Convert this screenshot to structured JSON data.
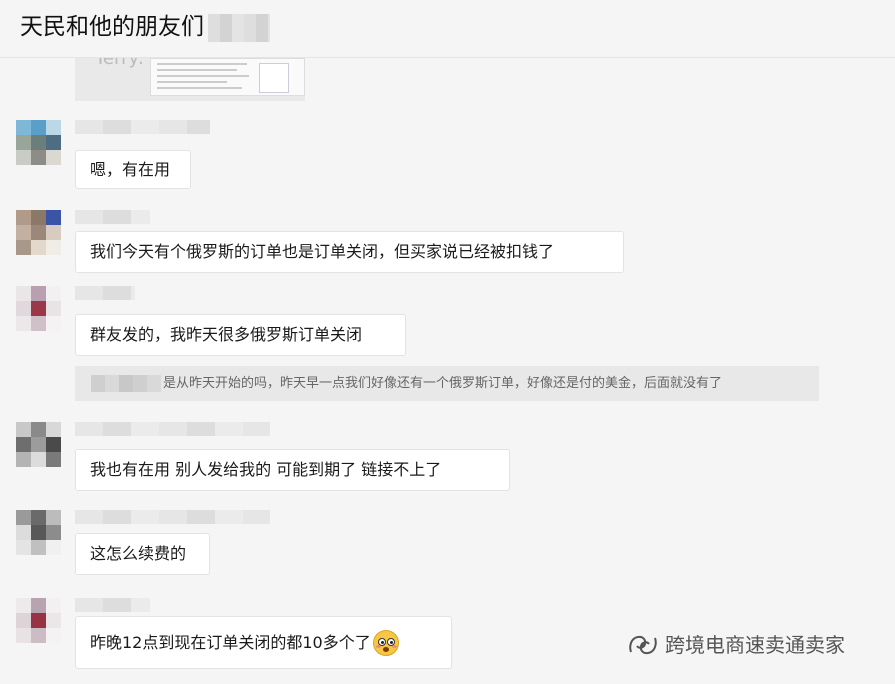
{
  "header": {
    "title": "天民和他的朋友们"
  },
  "image_message": {
    "label": "Terry:"
  },
  "messages": [
    {
      "text": "嗯，有在用"
    },
    {
      "text": "我们今天有个俄罗斯的订单也是订单关闭，但买家说已经被扣钱了"
    },
    {
      "text": "群友发的，我昨天很多俄罗斯订单关闭"
    },
    {
      "text": "我也有在用  别人发给我的  可能到期了  链接不上了"
    },
    {
      "text": "这怎么续费的"
    },
    {
      "text": "昨晚12点到现在订单关闭的都10多个了"
    }
  ],
  "quote": {
    "text": "是从昨天开始的吗，昨天早一点我们好像还有一个俄罗斯订单，好像还是付的美金，后面就没有了"
  },
  "emoji": {
    "icon": "flushed-face-icon"
  },
  "watermark": {
    "text": "跨境电商速卖通卖家",
    "icon": "wechat-channel-icon"
  },
  "colors": {
    "background": "#f5f5f5",
    "bubble": "#ffffff",
    "quote_bg": "#e8e8e8"
  }
}
